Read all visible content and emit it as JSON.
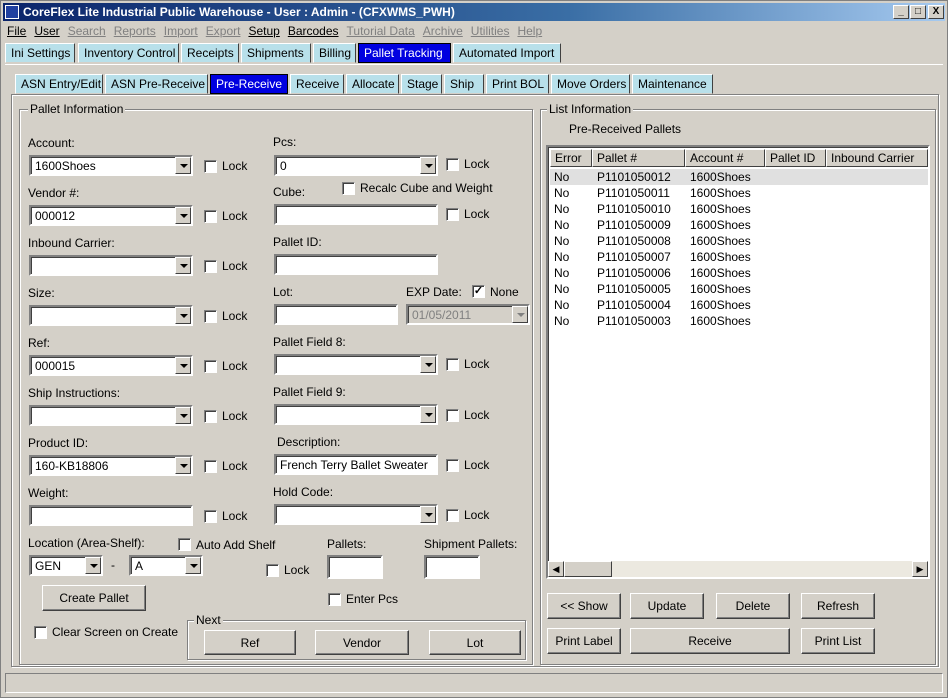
{
  "window": {
    "title": "CoreFlex Lite Industrial Public Warehouse - User : Admin - (CFXWMS_PWH)",
    "min": "_",
    "max": "□",
    "close": "X"
  },
  "menu": [
    {
      "label": "File",
      "enabled": true
    },
    {
      "label": "User",
      "enabled": true
    },
    {
      "label": "Search",
      "enabled": false
    },
    {
      "label": "Reports",
      "enabled": false
    },
    {
      "label": "Import",
      "enabled": false
    },
    {
      "label": "Export",
      "enabled": false
    },
    {
      "label": "Setup",
      "enabled": true
    },
    {
      "label": "Barcodes",
      "enabled": true
    },
    {
      "label": "Tutorial Data",
      "enabled": false
    },
    {
      "label": "Archive",
      "enabled": false
    },
    {
      "label": "Utilities",
      "enabled": false
    },
    {
      "label": "Help",
      "enabled": false
    }
  ],
  "main_tabs": [
    "Ini Settings",
    "Inventory Control",
    "Receipts",
    "Shipments",
    "Billing",
    "Pallet Tracking",
    "Automated Import"
  ],
  "sub_tabs": [
    "ASN Entry/Edit",
    "ASN Pre-Receive",
    "Pre-Receive",
    "Receive",
    "Allocate",
    "Stage",
    "Ship",
    "Print BOL",
    "Move Orders",
    "Maintenance"
  ],
  "pallet_info": {
    "title": "Pallet Information",
    "lock": "Lock",
    "account_label": "Account:",
    "account_value": "1600Shoes",
    "pcs_label": "Pcs:",
    "pcs_value": "0",
    "vendor_label": "Vendor #:",
    "vendor_value": "000012",
    "cube_label": "Cube:",
    "recalc_label": "Recalc Cube and Weight",
    "carrier_label": "Inbound Carrier:",
    "pallet_id_label": "Pallet ID:",
    "size_label": "Size:",
    "lot_label": "Lot:",
    "exp_label": "EXP Date:",
    "none_label": "None",
    "exp_value": "01/05/2011",
    "ref_label": "Ref:",
    "ref_value": "000015",
    "pf8_label": "Pallet Field 8:",
    "ship_label": "Ship Instructions:",
    "pf9_label": "Pallet Field 9:",
    "product_label": "Product ID:",
    "product_value": "160-KB18806",
    "desc_label": "Description:",
    "desc_value": "French Terry Ballet Sweater",
    "weight_label": "Weight:",
    "hold_label": "Hold Code:",
    "location_label": "Location (Area-Shelf):",
    "auto_add_label": "Auto Add Shelf",
    "area_value": "GEN",
    "dash": "-",
    "shelf_value": "A",
    "pallets_label": "Pallets:",
    "shipment_pallets_label": "Shipment Pallets:",
    "enter_pcs_label": "Enter Pcs",
    "create_pallet": "Create Pallet",
    "clear_screen_label": "Clear Screen on Create",
    "next_title": "Next",
    "next_ref": "Ref",
    "next_vendor": "Vendor",
    "next_lot": "Lot"
  },
  "list_info": {
    "title": "List Information",
    "subtitle": "Pre-Received Pallets",
    "columns": [
      "Error",
      "Pallet #",
      "Account #",
      "Pallet ID",
      "Inbound Carrier"
    ],
    "rows": [
      {
        "error": "No",
        "pallet": "P1101050012",
        "account": "1600Shoes"
      },
      {
        "error": "No",
        "pallet": "P1101050011",
        "account": "1600Shoes"
      },
      {
        "error": "No",
        "pallet": "P1101050010",
        "account": "1600Shoes"
      },
      {
        "error": "No",
        "pallet": "P1101050009",
        "account": "1600Shoes"
      },
      {
        "error": "No",
        "pallet": "P1101050008",
        "account": "1600Shoes"
      },
      {
        "error": "No",
        "pallet": "P1101050007",
        "account": "1600Shoes"
      },
      {
        "error": "No",
        "pallet": "P1101050006",
        "account": "1600Shoes"
      },
      {
        "error": "No",
        "pallet": "P1101050005",
        "account": "1600Shoes"
      },
      {
        "error": "No",
        "pallet": "P1101050004",
        "account": "1600Shoes"
      },
      {
        "error": "No",
        "pallet": "P1101050003",
        "account": "1600Shoes"
      }
    ],
    "buttons": {
      "show": "<< Show",
      "update": "Update",
      "delete": "Delete",
      "refresh": "Refresh",
      "print_label": "Print Label",
      "receive": "Receive",
      "print_list": "Print List"
    }
  }
}
